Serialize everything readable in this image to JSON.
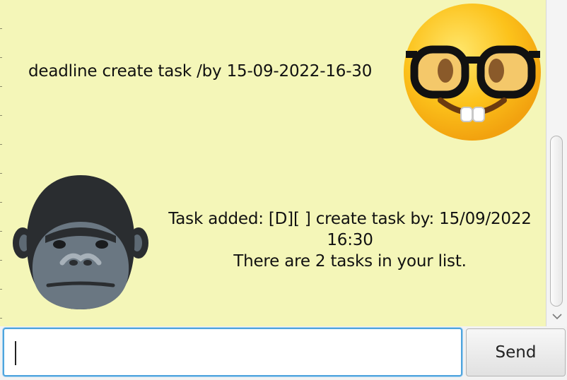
{
  "messages": {
    "user": {
      "text": "deadline create task /by 15-09-2022-16-30",
      "avatar": "nerd-face-emoji"
    },
    "bot": {
      "line1": "Task added: [D][ ] create task by: 15/09/2022",
      "line2": "16:30",
      "line3": "There are 2 tasks in your list.",
      "avatar": "gorilla-emoji"
    }
  },
  "input": {
    "value": "",
    "placeholder": ""
  },
  "send_button": {
    "label": "Send"
  },
  "colors": {
    "chat_background": "#f4f6b8",
    "input_focus_border": "#4fa4dd"
  }
}
